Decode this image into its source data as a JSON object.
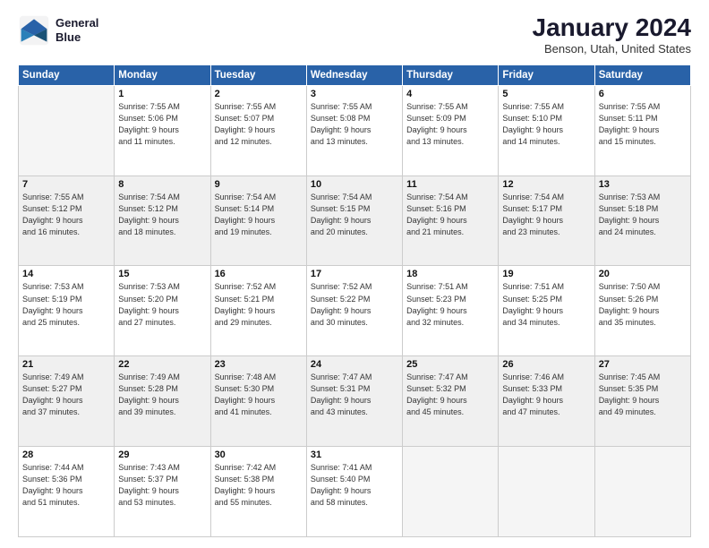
{
  "logo": {
    "line1": "General",
    "line2": "Blue"
  },
  "header": {
    "title": "January 2024",
    "location": "Benson, Utah, United States"
  },
  "weekdays": [
    "Sunday",
    "Monday",
    "Tuesday",
    "Wednesday",
    "Thursday",
    "Friday",
    "Saturday"
  ],
  "weeks": [
    [
      {
        "day": "",
        "info": ""
      },
      {
        "day": "1",
        "info": "Sunrise: 7:55 AM\nSunset: 5:06 PM\nDaylight: 9 hours\nand 11 minutes."
      },
      {
        "day": "2",
        "info": "Sunrise: 7:55 AM\nSunset: 5:07 PM\nDaylight: 9 hours\nand 12 minutes."
      },
      {
        "day": "3",
        "info": "Sunrise: 7:55 AM\nSunset: 5:08 PM\nDaylight: 9 hours\nand 13 minutes."
      },
      {
        "day": "4",
        "info": "Sunrise: 7:55 AM\nSunset: 5:09 PM\nDaylight: 9 hours\nand 13 minutes."
      },
      {
        "day": "5",
        "info": "Sunrise: 7:55 AM\nSunset: 5:10 PM\nDaylight: 9 hours\nand 14 minutes."
      },
      {
        "day": "6",
        "info": "Sunrise: 7:55 AM\nSunset: 5:11 PM\nDaylight: 9 hours\nand 15 minutes."
      }
    ],
    [
      {
        "day": "7",
        "info": "Sunrise: 7:55 AM\nSunset: 5:12 PM\nDaylight: 9 hours\nand 16 minutes."
      },
      {
        "day": "8",
        "info": "Sunrise: 7:54 AM\nSunset: 5:12 PM\nDaylight: 9 hours\nand 18 minutes."
      },
      {
        "day": "9",
        "info": "Sunrise: 7:54 AM\nSunset: 5:14 PM\nDaylight: 9 hours\nand 19 minutes."
      },
      {
        "day": "10",
        "info": "Sunrise: 7:54 AM\nSunset: 5:15 PM\nDaylight: 9 hours\nand 20 minutes."
      },
      {
        "day": "11",
        "info": "Sunrise: 7:54 AM\nSunset: 5:16 PM\nDaylight: 9 hours\nand 21 minutes."
      },
      {
        "day": "12",
        "info": "Sunrise: 7:54 AM\nSunset: 5:17 PM\nDaylight: 9 hours\nand 23 minutes."
      },
      {
        "day": "13",
        "info": "Sunrise: 7:53 AM\nSunset: 5:18 PM\nDaylight: 9 hours\nand 24 minutes."
      }
    ],
    [
      {
        "day": "14",
        "info": "Sunrise: 7:53 AM\nSunset: 5:19 PM\nDaylight: 9 hours\nand 25 minutes."
      },
      {
        "day": "15",
        "info": "Sunrise: 7:53 AM\nSunset: 5:20 PM\nDaylight: 9 hours\nand 27 minutes."
      },
      {
        "day": "16",
        "info": "Sunrise: 7:52 AM\nSunset: 5:21 PM\nDaylight: 9 hours\nand 29 minutes."
      },
      {
        "day": "17",
        "info": "Sunrise: 7:52 AM\nSunset: 5:22 PM\nDaylight: 9 hours\nand 30 minutes."
      },
      {
        "day": "18",
        "info": "Sunrise: 7:51 AM\nSunset: 5:23 PM\nDaylight: 9 hours\nand 32 minutes."
      },
      {
        "day": "19",
        "info": "Sunrise: 7:51 AM\nSunset: 5:25 PM\nDaylight: 9 hours\nand 34 minutes."
      },
      {
        "day": "20",
        "info": "Sunrise: 7:50 AM\nSunset: 5:26 PM\nDaylight: 9 hours\nand 35 minutes."
      }
    ],
    [
      {
        "day": "21",
        "info": "Sunrise: 7:49 AM\nSunset: 5:27 PM\nDaylight: 9 hours\nand 37 minutes."
      },
      {
        "day": "22",
        "info": "Sunrise: 7:49 AM\nSunset: 5:28 PM\nDaylight: 9 hours\nand 39 minutes."
      },
      {
        "day": "23",
        "info": "Sunrise: 7:48 AM\nSunset: 5:30 PM\nDaylight: 9 hours\nand 41 minutes."
      },
      {
        "day": "24",
        "info": "Sunrise: 7:47 AM\nSunset: 5:31 PM\nDaylight: 9 hours\nand 43 minutes."
      },
      {
        "day": "25",
        "info": "Sunrise: 7:47 AM\nSunset: 5:32 PM\nDaylight: 9 hours\nand 45 minutes."
      },
      {
        "day": "26",
        "info": "Sunrise: 7:46 AM\nSunset: 5:33 PM\nDaylight: 9 hours\nand 47 minutes."
      },
      {
        "day": "27",
        "info": "Sunrise: 7:45 AM\nSunset: 5:35 PM\nDaylight: 9 hours\nand 49 minutes."
      }
    ],
    [
      {
        "day": "28",
        "info": "Sunrise: 7:44 AM\nSunset: 5:36 PM\nDaylight: 9 hours\nand 51 minutes."
      },
      {
        "day": "29",
        "info": "Sunrise: 7:43 AM\nSunset: 5:37 PM\nDaylight: 9 hours\nand 53 minutes."
      },
      {
        "day": "30",
        "info": "Sunrise: 7:42 AM\nSunset: 5:38 PM\nDaylight: 9 hours\nand 55 minutes."
      },
      {
        "day": "31",
        "info": "Sunrise: 7:41 AM\nSunset: 5:40 PM\nDaylight: 9 hours\nand 58 minutes."
      },
      {
        "day": "",
        "info": ""
      },
      {
        "day": "",
        "info": ""
      },
      {
        "day": "",
        "info": ""
      }
    ]
  ]
}
